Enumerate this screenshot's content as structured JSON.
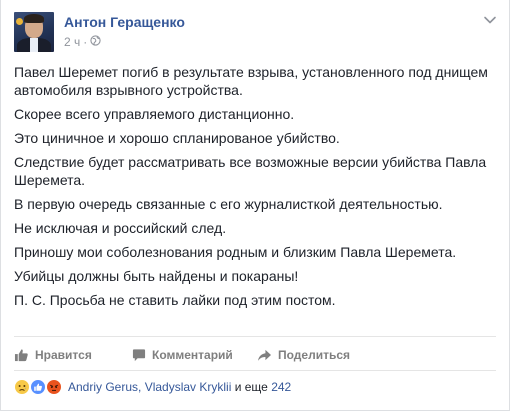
{
  "author": {
    "name": "Антон Геращенко",
    "time": "2 ч",
    "time_separator": "·"
  },
  "post": {
    "paragraphs": [
      "Павел Шеремет погиб в результате взрыва, установленного под днищем автомобиля взрывного устройства.",
      "Скорее всего управляемого дистанционно.",
      "Это циничное и хорошо спланированое убийство.",
      "Следствие будет рассматривать все возможные версии убийства Павла Шеремета.",
      "В первую очередь связанные с его журналисткой деятельностью.",
      "Не исключая и российский след.",
      "Приношу мои соболезнования родным и близким Павла Шеремета.",
      "Убийцы должны быть найдены и покараны!",
      "П. С. Просьба не ставить лайки под этим постом."
    ]
  },
  "actions": {
    "like": "Нравится",
    "comment": "Комментарий",
    "share": "Поделиться"
  },
  "reactions": {
    "names": "Andriy Gerus, Vladyslav Kryklii",
    "and": " и еще ",
    "count": "242",
    "icons": [
      "sad-reaction-icon",
      "like-reaction-icon",
      "angry-reaction-icon"
    ]
  },
  "colors": {
    "link": "#365899",
    "text": "#1d2129",
    "muted": "#90949c"
  }
}
